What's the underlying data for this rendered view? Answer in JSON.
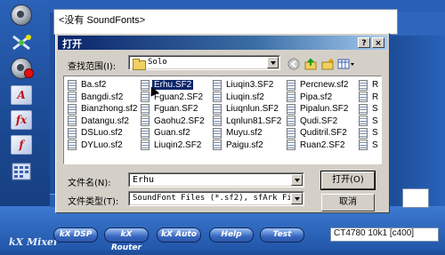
{
  "soundfont_panel": {
    "text": "<没有 SoundFonts>"
  },
  "mixer": {
    "title": "kX Mixer",
    "buttons": [
      "kX DSP",
      "kX Router",
      "kX Auto",
      "Help",
      "Test"
    ],
    "card_info": "CT4780 10k1 [c400]",
    "sidebar_icons": [
      "speaker-icon",
      "network-icon",
      "record-speaker-icon",
      "router-icon",
      "fx-icon",
      "function-icon",
      "grid-icon"
    ]
  },
  "dialog": {
    "title": "打开",
    "help_button": "?",
    "close_button": "×",
    "look_in_label": "查找范围(I):",
    "look_in_value": "Solo",
    "files": [
      [
        "Ba.sf2",
        "Erhu.SF2",
        "Liuqin3.SF2",
        "Percnew.sf2",
        "R"
      ],
      [
        "Bangdi.sf2",
        "Fguan2.SF2",
        "Liuqin.sf2",
        "Pipa.sf2",
        "R"
      ],
      [
        "Bianzhong.sf2",
        "Fguan.SF2",
        "Liuqnlun.SF2",
        "Pipalun.SF2",
        "S"
      ],
      [
        "Datangu.sf2",
        "Gaohu2.SF2",
        "Lqnlun81.SF2",
        "Qudi.SF2",
        "S"
      ],
      [
        "DSLuo.sf2",
        "Guan.sf2",
        "Muyu.sf2",
        "Quditril.SF2",
        "S"
      ],
      [
        "DYLuo.sf2",
        "Liuqin2.SF2",
        "Paigu.sf2",
        "Ruan2.SF2",
        "S"
      ]
    ],
    "selected_file": "Erhu.SF2",
    "filename_label": "文件名(N):",
    "filename_value": "Erhu",
    "filetype_label": "文件类型(T):",
    "filetype_value": "SoundFont Files (*.sf2), sfArk Files",
    "open_button": "打开(O)",
    "cancel_button": "取消"
  }
}
